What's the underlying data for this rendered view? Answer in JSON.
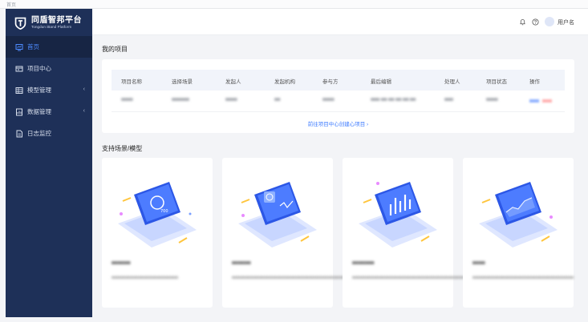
{
  "window": {
    "tab_label": "首页"
  },
  "brand": {
    "title": "同盾智邦平台",
    "subtitle": "Tongdun iBand Platform"
  },
  "sidebar": {
    "items": [
      {
        "label": "首页",
        "icon": "monitor-icon",
        "active": true,
        "expandable": false
      },
      {
        "label": "项目中心",
        "icon": "card-icon",
        "active": false,
        "expandable": false
      },
      {
        "label": "模型管理",
        "icon": "grid-icon",
        "active": false,
        "expandable": true
      },
      {
        "label": "数据管理",
        "icon": "chart-doc-icon",
        "active": false,
        "expandable": true
      },
      {
        "label": "日志监控",
        "icon": "document-icon",
        "active": false,
        "expandable": false
      }
    ]
  },
  "header": {
    "username": "用户名",
    "icons": [
      "bell-icon",
      "help-icon"
    ]
  },
  "projects": {
    "title": "我的项目",
    "columns": [
      "项目名称",
      "选择场景",
      "发起人",
      "发起机构",
      "参与方",
      "最后编辑",
      "处理人",
      "项目状态",
      "操作"
    ],
    "rows": [
      [
        "■■■■",
        "■■■■■■",
        "■■■■",
        "■■",
        "■■■■",
        "■■■-■■-■■ ■■:■■:■■",
        "■■■",
        "■■■■",
        ""
      ]
    ],
    "link": "前往项目中心创建心项目 ›"
  },
  "scenes": {
    "title": "支持场景/模型",
    "cards": [
      {
        "name": "■■■■■■",
        "desc": "■■■■■■■■■■■■■■■■■■■■■■■■■"
      },
      {
        "name": "■■■■■■",
        "desc": "■■■■■■■■■■■■■■■■■■■■■■■■■■■■■■■■■■■■■■■■■■■■■"
      },
      {
        "name": "■■■■■■■",
        "desc": "■■■■■■■■■■■■■■■■■■■■■■■■■■■■■■■■■■■■■■■■■■■"
      },
      {
        "name": "■■■■",
        "desc": "■■■■■■■■■■■■■■■■■■■■■■■■■■■■■■■■■■■■■■"
      }
    ]
  },
  "colors": {
    "sidebar": "#1e3058",
    "accent": "#3f7cff",
    "page": "#f3f4f7"
  }
}
